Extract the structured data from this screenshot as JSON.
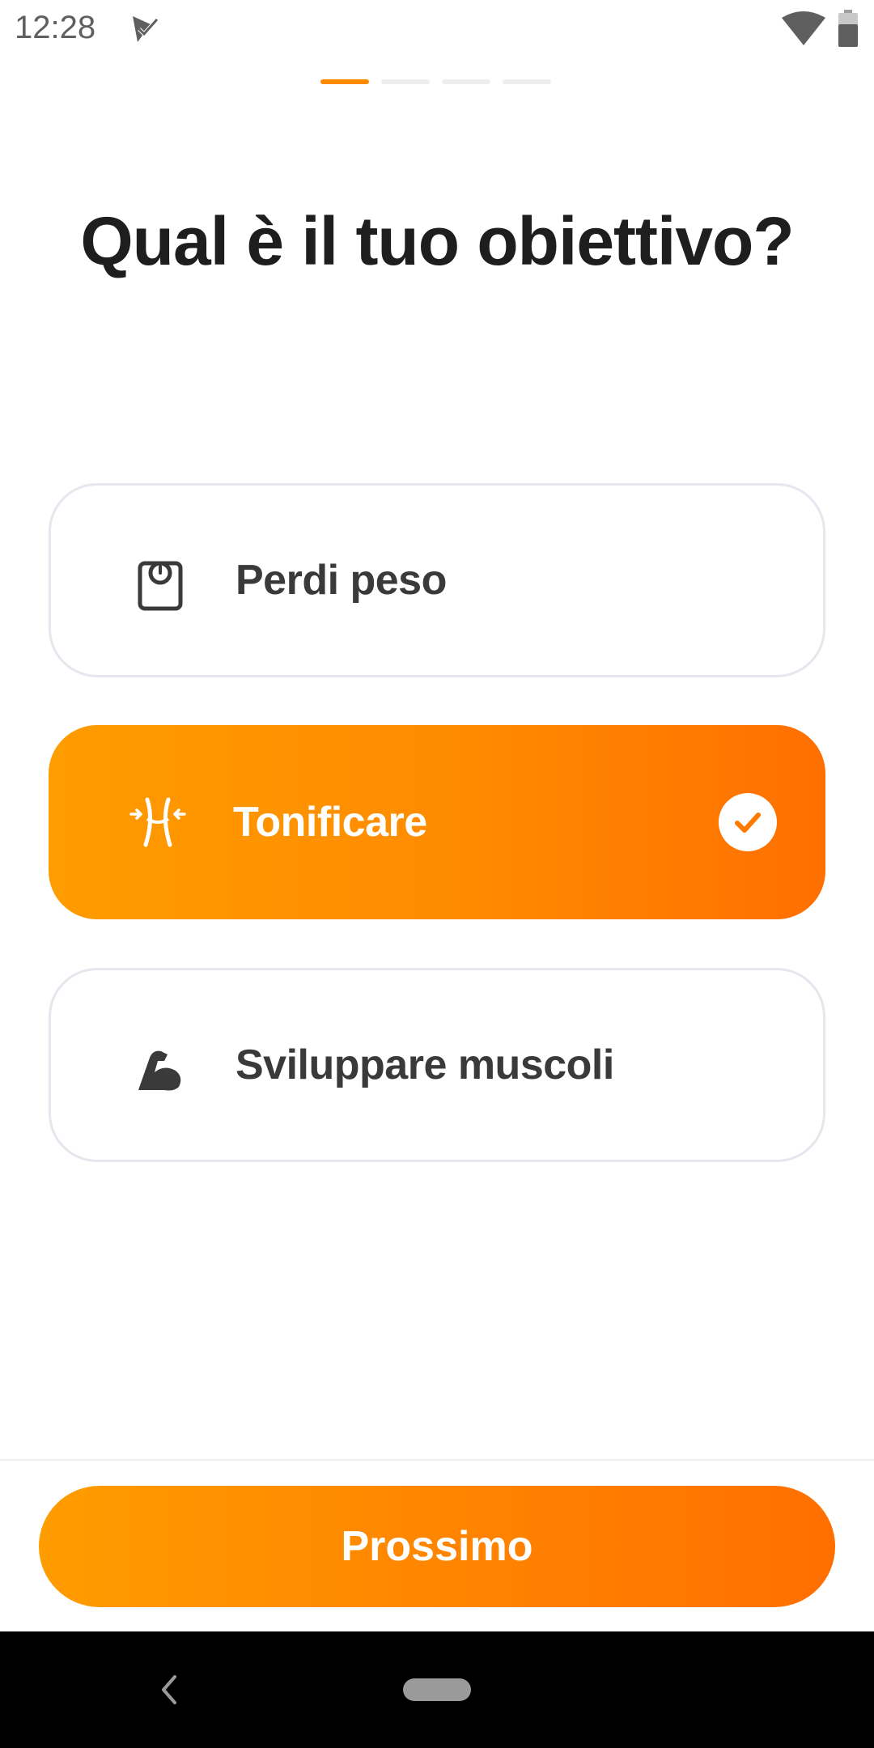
{
  "status_bar": {
    "time": "12:28",
    "icons": [
      "app-check-icon",
      "wifi-icon",
      "battery-icon"
    ]
  },
  "progress": {
    "total_steps": 4,
    "current_step": 1,
    "active_color": "#ff8a00"
  },
  "title": "Qual è il tuo obiettivo?",
  "options": [
    {
      "label": "Perdi peso",
      "icon": "scale-icon",
      "selected": false
    },
    {
      "label": "Tonificare",
      "icon": "waist-icon",
      "selected": true
    },
    {
      "label": "Sviluppare muscoli",
      "icon": "flexed-bicep-icon",
      "selected": false
    }
  ],
  "next_button": {
    "label": "Prossimo"
  },
  "colors": {
    "accent_start": "#ff9c00",
    "accent_end": "#ff6f00",
    "text_dark": "#1e1e1e",
    "option_text": "#3a3a3a",
    "option_border": "#e6e6ee"
  },
  "nav_bar": {
    "icons": [
      "back-icon",
      "home-pill-icon"
    ]
  }
}
